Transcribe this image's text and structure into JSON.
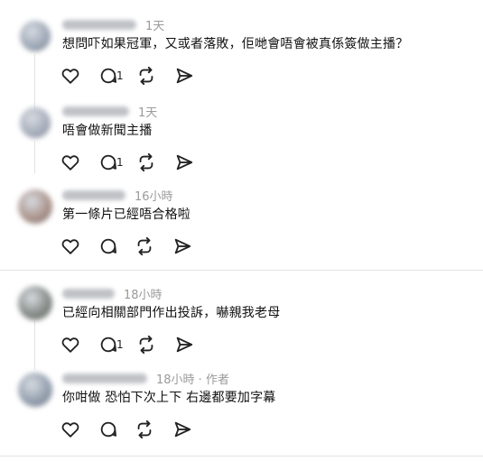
{
  "comments": [
    {
      "username": "",
      "time": "1天",
      "text": "想問吓如果冠軍，又或者落敗，佢哋會唔會被真係簽做主播？",
      "reply_count": "1",
      "avatar_color": "#9aa4b4"
    },
    {
      "username": "",
      "time": "1天",
      "text": "唔會做新聞主播",
      "reply_count": "1",
      "avatar_color": "#a3aab8"
    },
    {
      "username": "",
      "time": "16小時",
      "text": "第一條片已經唔合格啦",
      "reply_count": "",
      "avatar_color": "#a88f86"
    },
    {
      "username": "",
      "time": "18小時",
      "text": "已經向相關部門作出投訴，嚇親我老母",
      "reply_count": "1",
      "avatar_color": "#7f8580"
    },
    {
      "username": "",
      "time": "18小時 · 作者",
      "text": "你咁做 恐怕下次上下 右邊都要加字幕",
      "reply_count": "",
      "avatar_color": "#8e9aaa"
    }
  ],
  "icons": {
    "like": "heart-icon",
    "reply": "speech-bubble-icon",
    "repost": "repost-icon",
    "share": "send-icon"
  }
}
